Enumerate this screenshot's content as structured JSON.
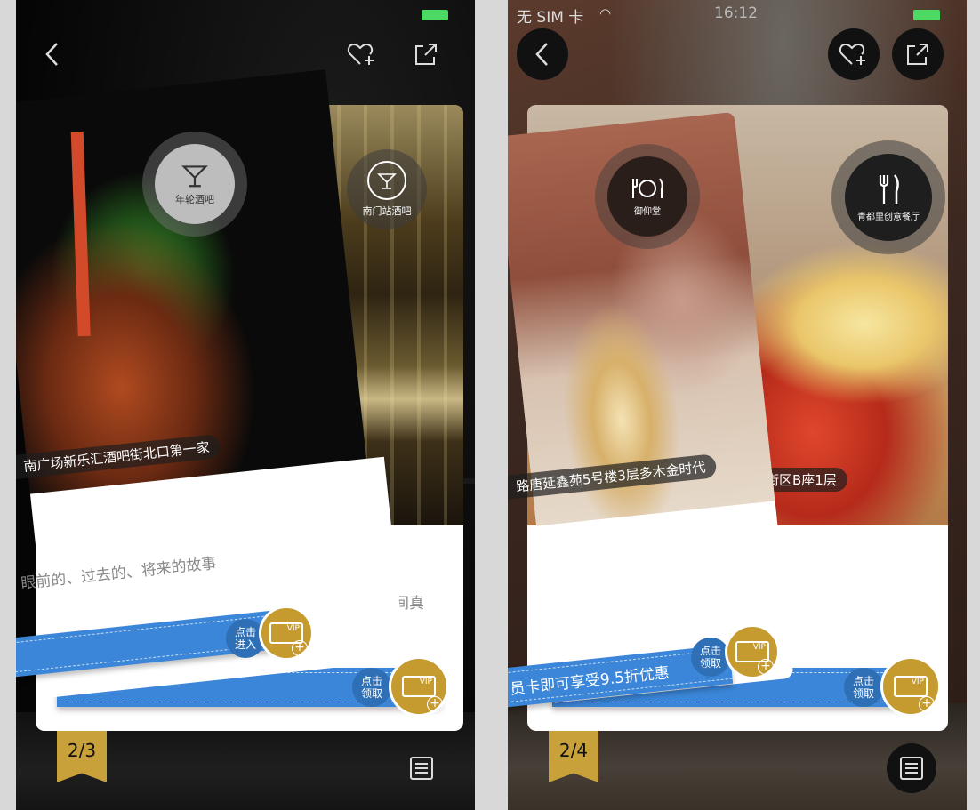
{
  "screen1": {
    "categories": [
      {
        "label": "年轮酒吧",
        "icon": "cocktail-icon"
      },
      {
        "label": "南门站酒吧",
        "icon": "cocktail-icon"
      }
    ],
    "address": "南广场新乐汇酒吧街北口第一家",
    "desc_back": "美酒，见人间真",
    "desc_front": "眼前的、过去的、将来的故事",
    "ribbon_front_action": "点击\n进入",
    "ribbon_back_action": "点击\n领取",
    "vip_label": "VIP",
    "page": "2/3"
  },
  "screen2": {
    "status": {
      "carrier": "无 SIM 卡",
      "time": "16:12"
    },
    "categories": [
      {
        "label": "御仰堂",
        "icon": "plate-cutlery-icon"
      },
      {
        "label": "青都里创意餐厅",
        "icon": "fork-knife-icon"
      }
    ],
    "address_front": "路唐延鑫苑5号楼3层多木金时代",
    "address_back": "街区B座1层",
    "ribbon_front_text": "员卡即可享受9.5折优惠",
    "ribbon_front_action": "点击\n领取",
    "ribbon_back_action": "点击\n领取",
    "vip_label": "VIP",
    "page": "2/4"
  },
  "colors": {
    "ribbon": "#3b86d8",
    "gold": "#c59a2e",
    "battery": "#4cd964"
  }
}
